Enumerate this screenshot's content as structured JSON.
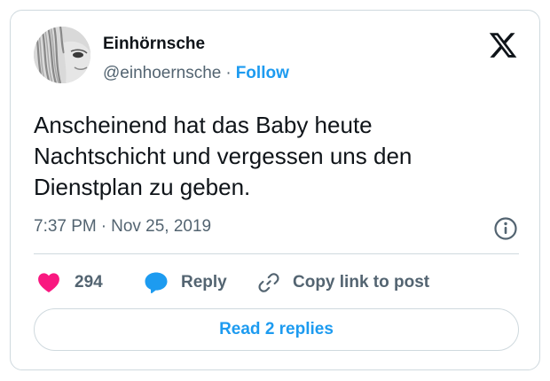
{
  "author": {
    "display_name": "Einhörnsche",
    "handle": "@einhoernsche",
    "separator": "·",
    "follow_label": "Follow"
  },
  "tweet": {
    "lines": [
      "Anscheinend hat das Baby heute",
      "Nachtschicht und vergessen uns den",
      "Dienstplan zu geben."
    ],
    "time": "7:37 PM",
    "separator": "·",
    "date": "Nov 25, 2019"
  },
  "actions": {
    "like_count": "294",
    "reply_label": "Reply",
    "copy_label": "Copy link to post"
  },
  "read_replies_label": "Read 2 replies",
  "icons": {
    "platform_logo": "x-logo-icon",
    "info": "info-icon",
    "like": "heart-icon",
    "reply": "speech-bubble-icon",
    "copy": "link-icon"
  },
  "colors": {
    "accent": "#1d9bf0",
    "like": "#f91880",
    "text": "#0f1419",
    "secondary": "#536471",
    "border": "#cfd9de"
  }
}
